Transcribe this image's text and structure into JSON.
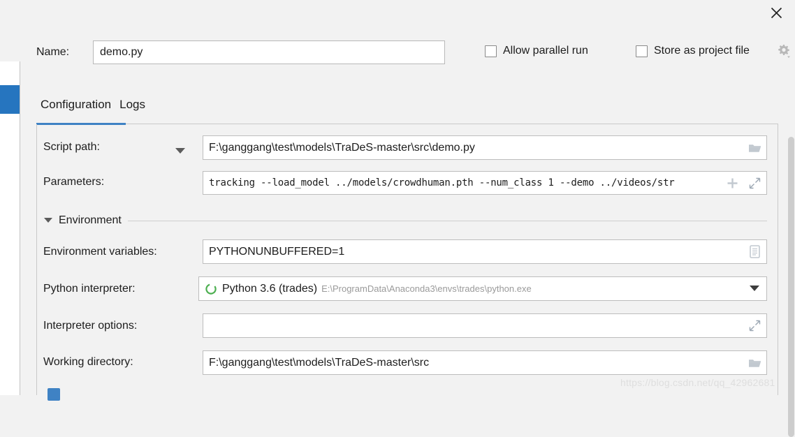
{
  "window": {
    "close_label": "×",
    "close_icon": "close-icon"
  },
  "name_row": {
    "label": "Name:",
    "value": "demo.py",
    "placeholder": "",
    "allow_parallel_run": {
      "label": "Allow parallel run",
      "checked": false
    },
    "store_as_project_file": {
      "label": "Store as project file",
      "checked": false
    },
    "gear_icon": "gear-dropdown-icon"
  },
  "tabs": [
    {
      "label": "Configuration",
      "active": true
    },
    {
      "label": "Logs",
      "active": false
    }
  ],
  "form": {
    "script_path": {
      "label": "Script path:",
      "value": "F:\\ganggang\\test\\models\\TraDeS-master\\src\\demo.py",
      "icon": "folder-icon",
      "combo_icon": "chevron-down-icon"
    },
    "parameters": {
      "label": "Parameters:",
      "value": "tracking --load_model ../models/crowdhuman.pth --num_class 1 --demo ../videos/str",
      "add_icon": "plus-icon",
      "expand_icon": "expand-icon"
    },
    "environment_group": {
      "label": "Environment",
      "expanded": true,
      "caret_icon": "caret-down-icon"
    },
    "environment_variables": {
      "label": "Environment variables:",
      "value": "PYTHONUNBUFFERED=1",
      "icon": "list-editor-icon"
    },
    "python_interpreter": {
      "label": "Python interpreter:",
      "value": "Python 3.6 (trades)",
      "path": "E:\\ProgramData\\Anaconda3\\envs\\trades\\python.exe",
      "status_icon": "python-env-loading-icon",
      "dropdown_icon": "chevron-down-icon"
    },
    "interpreter_options": {
      "label": "Interpreter options:",
      "value": "",
      "expand_icon": "expand-icon"
    },
    "working_directory": {
      "label": "Working directory:",
      "value": "F:\\ganggang\\test\\models\\TraDeS-master\\src",
      "icon": "folder-icon"
    }
  },
  "watermark": {
    "text": "https://blog.csdn.net/qq_42962681"
  },
  "colors": {
    "accent": "#3f82c4",
    "selection": "#2675bf",
    "background": "#f2f2f2",
    "field_background": "#ffffff",
    "python_ok": "#4caf50"
  }
}
